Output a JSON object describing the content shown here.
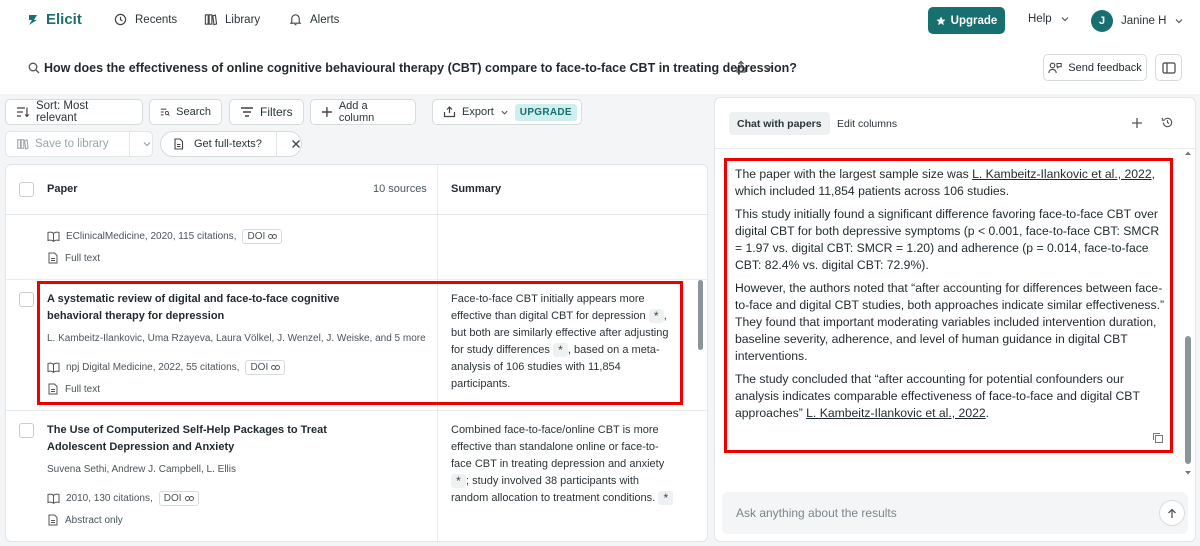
{
  "nav": {
    "brand": "Elicit",
    "recents": "Recents",
    "library": "Library",
    "alerts": "Alerts",
    "upgrade": "Upgrade",
    "help": "Help",
    "user_initial": "J",
    "user_name": "Janine H"
  },
  "query": {
    "text": "How does the effectiveness of online cognitive behavioural therapy (CBT) compare to face-to-face CBT in treating depression?",
    "send_feedback": "Send feedback"
  },
  "toolbar": {
    "sort": "Sort: Most relevant",
    "search": "Search",
    "filters": "Filters",
    "add_column": "Add a column",
    "export": "Export",
    "upgrade_badge": "UPGRADE",
    "save_library": "Save to library",
    "get_fulltexts": "Get full-texts?"
  },
  "table": {
    "col_paper": "Paper",
    "sources": "10 sources",
    "col_summary": "Summary",
    "partial_row": {
      "meta": "EClinicalMedicine, 2020, 115 citations,",
      "doi": "DOI",
      "availability": "Full text"
    },
    "rows": [
      {
        "title": "A systematic review of digital and face-to-face cognitive behavioral therapy for depression",
        "authors": "L. Kambeitz-Ilankovic, Uma Rzayeva, Laura Völkel, J. Wenzel, J. Weiske, and 5 more",
        "meta": "npj Digital Medicine, 2022, 55 citations,",
        "doi": "DOI",
        "availability": "Full text",
        "summary_1": "Face-to-face CBT initially appears more effective than digital CBT for depression",
        "summary_2": ", but both are similarly effective after adjusting for study differences",
        "summary_3": ", based on a meta-analysis of 106 studies with 11,854 participants."
      },
      {
        "title": "The Use of Computerized Self-Help Packages to Treat Adolescent Depression and Anxiety",
        "authors": "Suvena Sethi, Andrew J. Campbell, L. Ellis",
        "meta": "2010, 130 citations,",
        "doi": "DOI",
        "availability": "Abstract only",
        "summary_1": "Combined face-to-face/online CBT is more effective than standalone online or face-to-face CBT in treating depression and anxiety",
        "summary_2": "; study involved 38 participants with random allocation to treatment conditions."
      }
    ]
  },
  "chat": {
    "tab_chat": "Chat with papers",
    "tab_edit": "Edit columns",
    "p1_a": "The paper with the largest sample size was ",
    "p1_link": "L. Kambeitz-Ilankovic et al., 2022",
    "p1_b": ", which included 11,854 patients across 106 studies.",
    "p2": "This study initially found a significant difference favoring face-to-face CBT over digital CBT for both depressive symptoms (p < 0.001, face-to-face CBT: SMCR = 1.97 vs. digital CBT: SMCR = 1.20) and adherence (p = 0.014, face-to-face CBT: 82.4% vs. digital CBT: 72.9%).",
    "p3": "However, the authors noted that “after accounting for differences between face-to-face and digital CBT studies, both approaches indicate similar effectiveness.” They found that important moderating variables included intervention duration, baseline severity, adherence, and level of human guidance in digital CBT interventions.",
    "p4_a": "The study concluded that “after accounting for potential confounders our analysis indicates comparable effectiveness of face-to-face and digital CBT approaches” ",
    "p4_link": "L. Kambeitz-Ilankovic et al., 2022",
    "p4_b": ".",
    "ask_placeholder": "Ask anything about the results"
  },
  "colors": {
    "accent": "#17706f",
    "highlight": "#e00000"
  }
}
